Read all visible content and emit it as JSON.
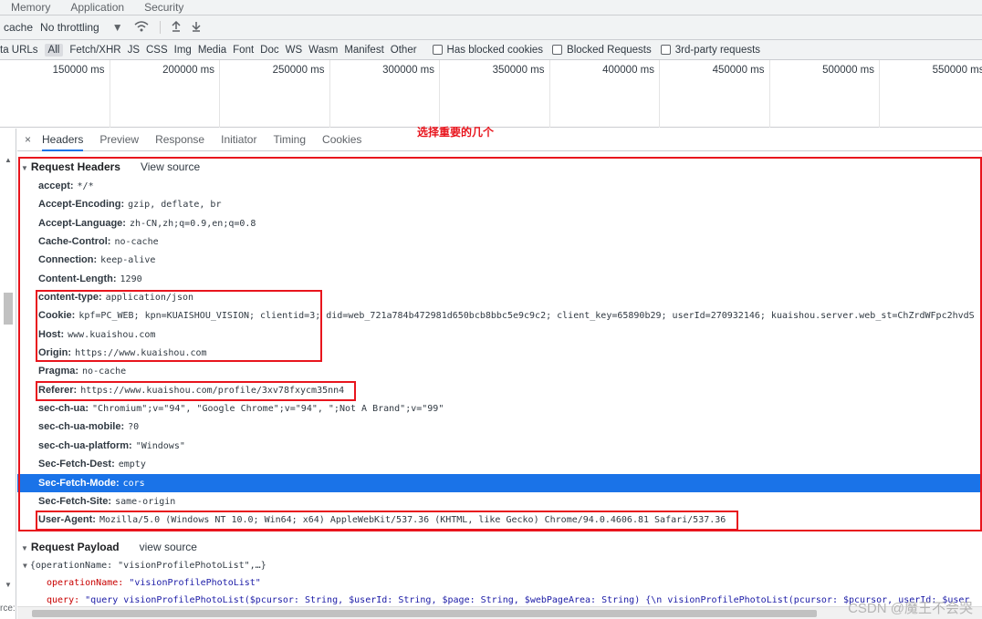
{
  "top_tabs": [
    "Memory",
    "Application",
    "Security"
  ],
  "throttle": {
    "cache_label": "cache",
    "throttling": "No throttling",
    "dropdown_icon": "caret-down",
    "icons": [
      "wifi-settings-icon",
      "upload-icon",
      "download-icon"
    ]
  },
  "filter": {
    "chips": [
      "ta URLs",
      "All",
      "Fetch/XHR",
      "JS",
      "CSS",
      "Img",
      "Media",
      "Font",
      "Doc",
      "WS",
      "Wasm",
      "Manifest",
      "Other"
    ],
    "active": "All",
    "checkboxes": [
      "Has blocked cookies",
      "Blocked Requests",
      "3rd-party requests"
    ]
  },
  "timeline": {
    "labels": [
      "150000 ms",
      "200000 ms",
      "250000 ms",
      "300000 ms",
      "350000 ms",
      "400000 ms",
      "450000 ms",
      "500000 ms",
      "550000 ms"
    ]
  },
  "detail_tabs": {
    "close": "×",
    "tabs": [
      "Headers",
      "Preview",
      "Response",
      "Initiator",
      "Timing",
      "Cookies"
    ],
    "active": "Headers"
  },
  "annotation": "选择重要的几个",
  "request_headers": {
    "title": "Request Headers",
    "view_source": "View source",
    "rows": [
      {
        "k": "accept:",
        "v": "*/*"
      },
      {
        "k": "Accept-Encoding:",
        "v": "gzip, deflate, br"
      },
      {
        "k": "Accept-Language:",
        "v": "zh-CN,zh;q=0.9,en;q=0.8"
      },
      {
        "k": "Cache-Control:",
        "v": "no-cache"
      },
      {
        "k": "Connection:",
        "v": "keep-alive"
      },
      {
        "k": "Content-Length:",
        "v": "1290"
      },
      {
        "k": "content-type:",
        "v": "application/json"
      },
      {
        "k": "Cookie:",
        "v": "kpf=PC_WEB; kpn=KUAISHOU_VISION; clientid=3; did=web_721a784b472981d650bcb8bbc5e9c9c2; client_key=65890b29; userId=270932146; kuaishou.server.web_st=ChZrdWFpc2hvdS"
      },
      {
        "k": "Host:",
        "v": "www.kuaishou.com"
      },
      {
        "k": "Origin:",
        "v": "https://www.kuaishou.com"
      },
      {
        "k": "Pragma:",
        "v": "no-cache"
      },
      {
        "k": "Referer:",
        "v": "https://www.kuaishou.com/profile/3xv78fxycm35nn4"
      },
      {
        "k": "sec-ch-ua:",
        "v": "\"Chromium\";v=\"94\", \"Google Chrome\";v=\"94\", \";Not A Brand\";v=\"99\""
      },
      {
        "k": "sec-ch-ua-mobile:",
        "v": "?0"
      },
      {
        "k": "sec-ch-ua-platform:",
        "v": "\"Windows\""
      },
      {
        "k": "Sec-Fetch-Dest:",
        "v": "empty"
      },
      {
        "k": "Sec-Fetch-Mode:",
        "v": "cors"
      },
      {
        "k": "Sec-Fetch-Site:",
        "v": "same-origin"
      },
      {
        "k": "User-Agent:",
        "v": "Mozilla/5.0 (Windows NT 10.0; Win64; x64) AppleWebKit/537.36 (KHTML, like Gecko) Chrome/94.0.4606.81 Safari/537.36"
      }
    ],
    "selected": "Sec-Fetch-Mode:"
  },
  "payload": {
    "title": "Request Payload",
    "view_source": "view source",
    "summary": "{operationName: \"visionProfilePhotoList\",…}",
    "op_key": "operationName:",
    "op_val": "\"visionProfilePhotoList\"",
    "query_key": "query:",
    "query_val": "\"query visionProfilePhotoList($pcursor: String, $userId: String, $page: String, $webPageArea: String) {\\n  visionProfilePhotoList(pcursor: $pcursor, userId: $user"
  },
  "left_pane_fragment": "rce:",
  "watermark": "CSDN @魔王不会哭"
}
